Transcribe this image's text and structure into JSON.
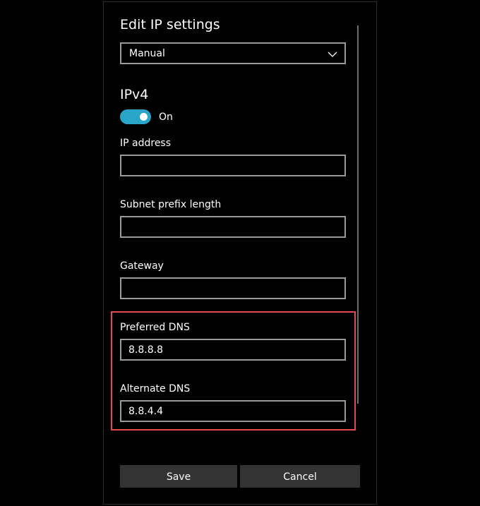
{
  "dialog": {
    "title": "Edit IP settings",
    "mode_select": {
      "value": "Manual",
      "icon": "chevron-down-icon"
    }
  },
  "ipv4": {
    "heading": "IPv4",
    "toggle": {
      "state": "On",
      "on": true
    },
    "fields": {
      "ip_address": {
        "label": "IP address",
        "value": ""
      },
      "subnet_prefix_length": {
        "label": "Subnet prefix length",
        "value": ""
      },
      "gateway": {
        "label": "Gateway",
        "value": ""
      },
      "preferred_dns": {
        "label": "Preferred DNS",
        "value": "8.8.8.8"
      },
      "alternate_dns": {
        "label": "Alternate DNS",
        "value": "8.8.4.4"
      }
    }
  },
  "buttons": {
    "save_label": "Save",
    "cancel_label": "Cancel"
  },
  "colors": {
    "accent": "#29a5c7",
    "highlight_border": "#e5484d",
    "input_border": "#9a9a9a",
    "button_bg": "#333333",
    "background": "#000000"
  }
}
